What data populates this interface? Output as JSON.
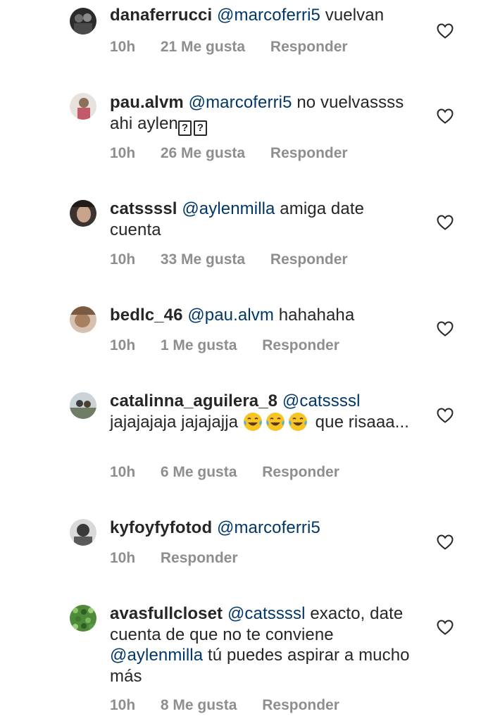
{
  "like_label": "Me gusta",
  "reply_label": "Responder",
  "comments": [
    {
      "username": "danaferrucci",
      "mention": "@marcoferri5",
      "text": " vuelvan",
      "time": "10h",
      "likes": "21 Me gusta",
      "reply": "Responder"
    },
    {
      "username": "pau.alvm",
      "mention": "@marcoferri5",
      "text": " no vuelvassss ahi aylen",
      "symbols": [
        "?",
        "?"
      ],
      "time": "10h",
      "likes": "26 Me gusta",
      "reply": "Responder"
    },
    {
      "username": "catssssl",
      "mention": "@aylenmilla",
      "text": " amiga date cuenta",
      "time": "10h",
      "likes": "33 Me gusta",
      "reply": "Responder"
    },
    {
      "username": "bedlc_46",
      "mention": "@pau.alvm",
      "text": " hahahaha",
      "time": "10h",
      "likes": "1 Me gusta",
      "reply": "Responder"
    },
    {
      "username": "catalinna_aguilera_8",
      "mention": "@catssssl",
      "text": " jajajajaja jajajajja",
      "emoji": "tears-of-joy",
      "text_after": " que risaaa...",
      "time": "10h",
      "likes": "6 Me gusta",
      "reply": "Responder"
    },
    {
      "username": "kyfoyfyfotod",
      "mention": "@marcoferri5",
      "text": "",
      "time": "10h",
      "likes": "",
      "reply": "Responder"
    },
    {
      "username": "avasfullcloset",
      "mention": "@catssssl",
      "text": " exacto, date cuenta de que no te conviene ",
      "mention2": "@aylenmilla",
      "text_after": " tú puedes aspirar a mucho más",
      "time": "10h",
      "likes": "8 Me gusta",
      "reply": "Responder"
    }
  ],
  "colors": {
    "text": "#262626",
    "mention": "#00376b",
    "meta": "#8e8e8e"
  }
}
